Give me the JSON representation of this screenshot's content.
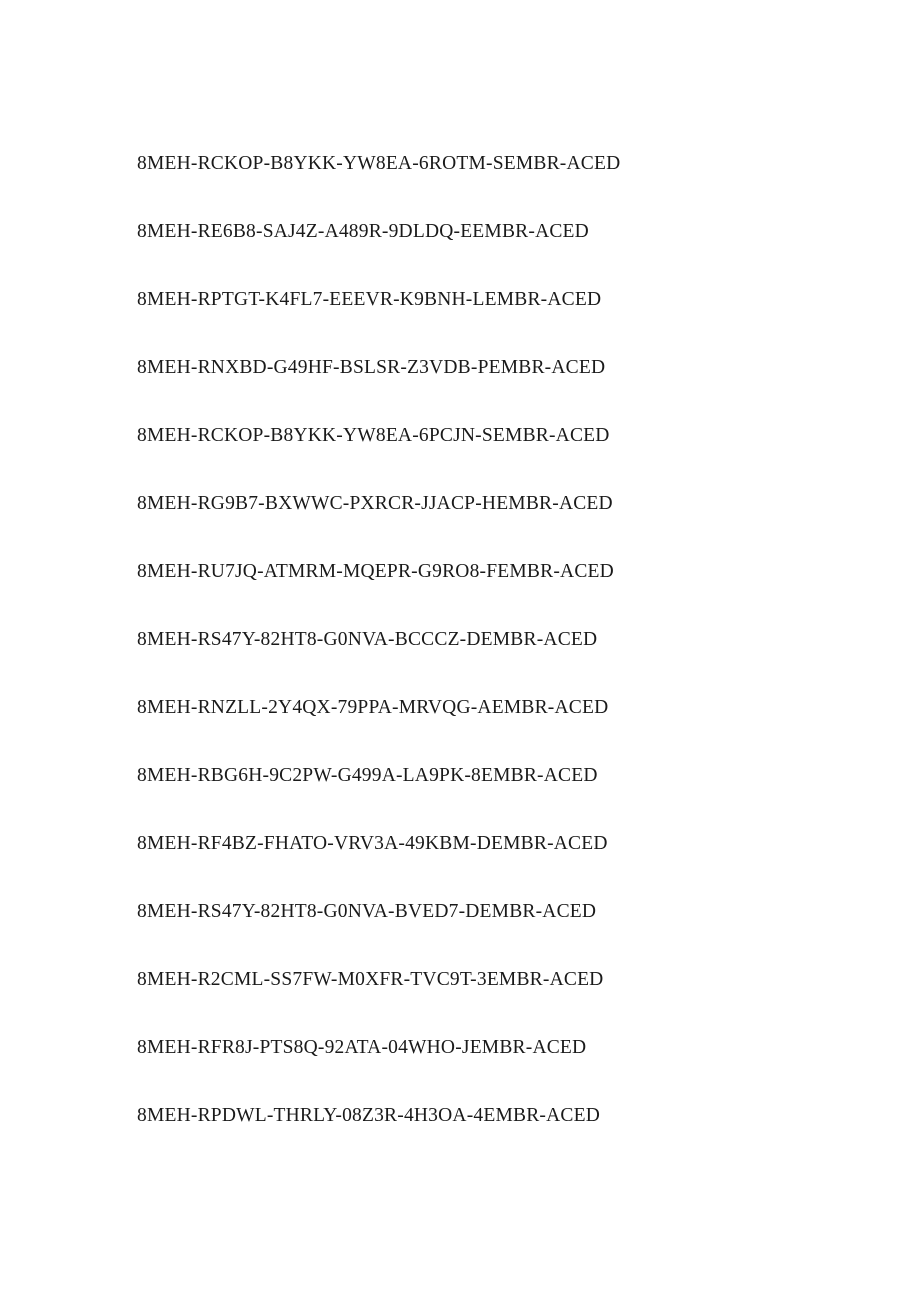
{
  "document": {
    "page_background": "#ffffff",
    "text_color": "#1a1a1a",
    "keys": [
      "8MEH-RCKOP-B8YKK-YW8EA-6ROTM-SEMBR-ACED",
      "8MEH-RE6B8-SAJ4Z-A489R-9DLDQ-EEMBR-ACED",
      "8MEH-RPTGT-K4FL7-EEEVR-K9BNH-LEMBR-ACED",
      "8MEH-RNXBD-G49HF-BSLSR-Z3VDB-PEMBR-ACED",
      "8MEH-RCKOP-B8YKK-YW8EA-6PCJN-SEMBR-ACED",
      "8MEH-RG9B7-BXWWC-PXRCR-JJACP-HEMBR-ACED",
      "8MEH-RU7JQ-ATMRM-MQEPR-G9RO8-FEMBR-ACED",
      "8MEH-RS47Y-82HT8-G0NVA-BCCCZ-DEMBR-ACED",
      "8MEH-RNZLL-2Y4QX-79PPA-MRVQG-AEMBR-ACED",
      "8MEH-RBG6H-9C2PW-G499A-LA9PK-8EMBR-ACED",
      "8MEH-RF4BZ-FHATO-VRV3A-49KBM-DEMBR-ACED",
      "8MEH-RS47Y-82HT8-G0NVA-BVED7-DEMBR-ACED",
      "8MEH-R2CML-SS7FW-M0XFR-TVC9T-3EMBR-ACED",
      "8MEH-RFR8J-PTS8Q-92ATA-04WHO-JEMBR-ACED",
      "8MEH-RPDWL-THRLY-08Z3R-4H3OA-4EMBR-ACED"
    ]
  }
}
